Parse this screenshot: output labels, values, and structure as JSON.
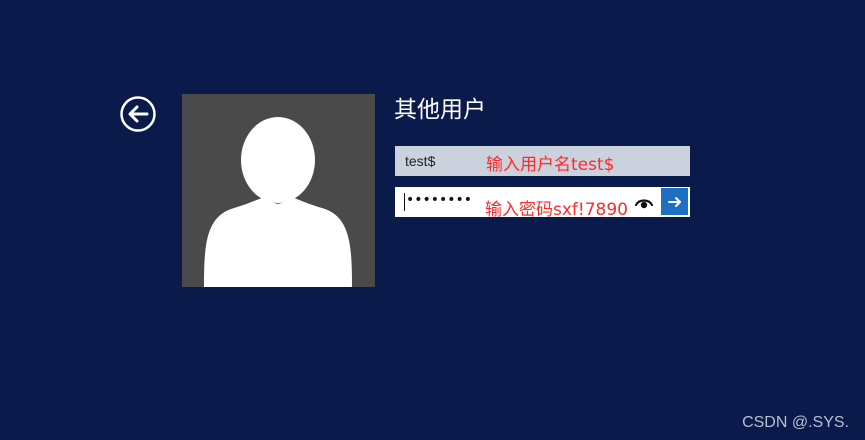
{
  "login": {
    "title": "其他用户",
    "username_value": "test$",
    "password_masked": "••••••••",
    "icons": {
      "back": "back-arrow-icon",
      "avatar": "user-silhouette-icon",
      "reveal": "eye-icon",
      "submit": "arrow-right-icon"
    }
  },
  "annotations": {
    "username_hint": "输入用户名test$",
    "password_hint": "输入密码sxf!7890"
  },
  "watermark": "CSDN @.SYS.",
  "colors": {
    "background": "#0a1a4a",
    "annotation": "#ff2a2a",
    "submit": "#1e6fc1"
  }
}
